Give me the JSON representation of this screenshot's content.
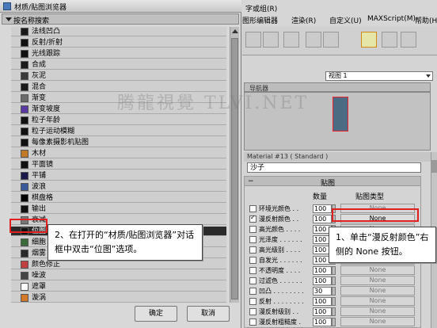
{
  "dialog": {
    "title": "材质/贴图浏览器",
    "sort_placeholder": "按名称搜索",
    "items": [
      {
        "label": "法线凹凸",
        "swatch": "#1a1a1a"
      },
      {
        "label": "反射/折射",
        "swatch": "#111111"
      },
      {
        "label": "光线跟踪",
        "swatch": "#111111"
      },
      {
        "label": "合成",
        "swatch": "#1a1a1a"
      },
      {
        "label": "灰泥",
        "swatch": "#3a3a3a"
      },
      {
        "label": "混合",
        "swatch": "#1a1a1a"
      },
      {
        "label": "渐变",
        "swatch": "#6a6a6a"
      },
      {
        "label": "渐变坡度",
        "swatch": "#5a3aa0"
      },
      {
        "label": "粒子年龄",
        "swatch": "#111111"
      },
      {
        "label": "粒子运动模糊",
        "swatch": "#111111"
      },
      {
        "label": "每像素摄影机贴图",
        "swatch": "#111111"
      },
      {
        "label": "木材",
        "swatch": "#c07a2a"
      },
      {
        "label": "平面镜",
        "swatch": "#111111"
      },
      {
        "label": "平铺",
        "swatch": "#1a1a4a"
      },
      {
        "label": "波浪",
        "swatch": "#3a5a9a"
      },
      {
        "label": "棋盘格",
        "swatch": "#000000"
      },
      {
        "label": "输出",
        "swatch": "#111111"
      },
      {
        "label": "衰减",
        "swatch": "#777777"
      },
      {
        "label": "位图",
        "swatch": "#111111"
      },
      {
        "label": "细胞",
        "swatch": "#3a6a3a"
      },
      {
        "label": "烟雾",
        "swatch": "#2a2a2a"
      },
      {
        "label": "颜色修正",
        "swatch": "#c04040"
      },
      {
        "label": "噪波",
        "swatch": "#444444"
      },
      {
        "label": "遮罩",
        "swatch": "#ffffff"
      },
      {
        "label": "漩涡",
        "swatch": "#d07a2a"
      }
    ],
    "selected_index": 18,
    "ok_label": "确定",
    "cancel_label": "取消"
  },
  "menubar": {
    "items": [
      "字或组(R)",
      "图形编辑器",
      "渲染(R)",
      "自定义(U)",
      "MAXScript(M)",
      "帮助(H)"
    ]
  },
  "viewport": {
    "select_value": "视图 1",
    "header": "导航器"
  },
  "material": {
    "header": "Material #13 ( Standard )",
    "name": "沙子",
    "rollout_title": "贴图",
    "col_amount": "数量",
    "col_type": "贴图类型",
    "rows": [
      {
        "name": "环境光颜色 . .",
        "checked": false,
        "amount": "100",
        "map": "None",
        "active": false
      },
      {
        "name": "漫反射颜色 . .",
        "checked": true,
        "amount": "100",
        "map": "None",
        "active": true
      },
      {
        "name": "高光颜色 . . . .",
        "checked": false,
        "amount": "100",
        "map": "None",
        "active": false
      },
      {
        "name": "光泽度 . . . . . .",
        "checked": false,
        "amount": "100",
        "map": "None",
        "active": false
      },
      {
        "name": "高光级别 . . . .",
        "checked": false,
        "amount": "100",
        "map": "None",
        "active": false
      },
      {
        "name": "自发光 . . . . . .",
        "checked": false,
        "amount": "100",
        "map": "None",
        "active": false
      },
      {
        "name": "不透明度 . . . .",
        "checked": false,
        "amount": "100",
        "map": "None",
        "active": false
      },
      {
        "name": "过滤色 . . . . . .",
        "checked": false,
        "amount": "100",
        "map": "None",
        "active": false
      },
      {
        "name": "凹凸 . . . . . . . .",
        "checked": false,
        "amount": "30",
        "map": "None",
        "active": false
      },
      {
        "name": "反射 . . . . . . . .",
        "checked": false,
        "amount": "100",
        "map": "None",
        "active": false
      },
      {
        "name": "漫反射级别 . .",
        "checked": false,
        "amount": "100",
        "map": "None",
        "active": false
      },
      {
        "name": "漫反射粗糙度 .",
        "checked": false,
        "amount": "100",
        "map": "None",
        "active": false
      }
    ]
  },
  "callouts": {
    "left": "2、在打开的“材质/贴图浏览器”对话框中双击“位图”选项。",
    "right": "1、单击“漫反射颜色”右侧的 None 按钮。"
  },
  "watermark": "腾龍視覺 TLVI.NET"
}
